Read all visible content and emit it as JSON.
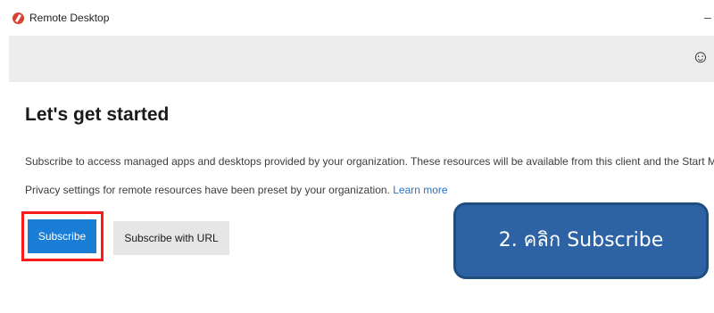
{
  "window": {
    "title": "Remote Desktop",
    "minimize_glyph": "–"
  },
  "commandbar": {
    "feedback_icon": "smiley-icon"
  },
  "main": {
    "heading": "Let's get started",
    "description": "Subscribe to access managed apps and desktops provided by your organization. These resources will be available from this client and the Start Menu.",
    "privacy_text": "Privacy settings for remote resources have been preset by your organization.",
    "learn_more": "Learn more",
    "subscribe_label": "Subscribe",
    "subscribe_url_label": "Subscribe with URL"
  },
  "annotation": {
    "callout_text": "2. คลิก Subscribe",
    "highlight_color": "#ff1a1a",
    "callout_color": "#2d63a4"
  },
  "colors": {
    "accent": "#1b7ed6",
    "link": "#2a73c5"
  }
}
